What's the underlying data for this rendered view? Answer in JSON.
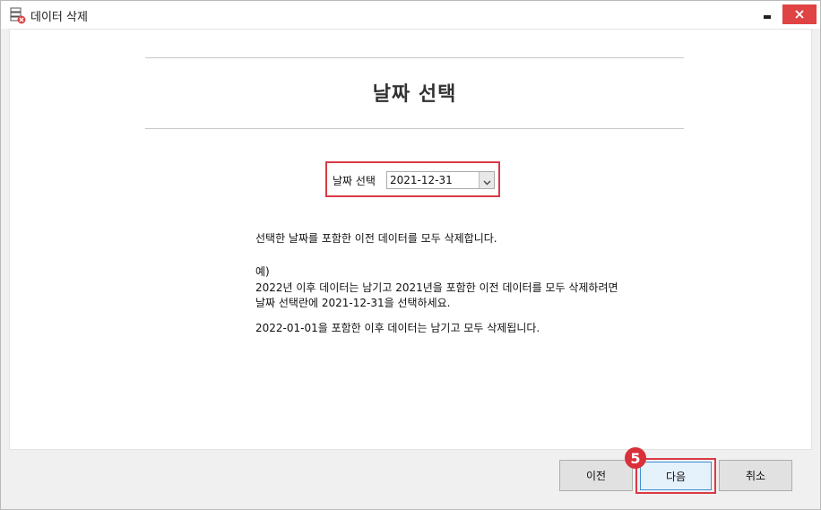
{
  "window": {
    "title": "데이터 삭제",
    "icon": "database-delete-icon"
  },
  "main": {
    "heading": "날짜 선택",
    "date_selector": {
      "label": "날짜 선택",
      "value": "2021-12-31"
    },
    "description": {
      "line1": "선택한 날짜를 포함한 이전 데이터를 모두 삭제합니다.",
      "example_label": "예)",
      "example_line1": "2022년 이후 데이터는 남기고 2021년을 포함한 이전 데이터를 모두 삭제하려면",
      "example_line2": "날짜 선택란에 2021-12-31을 선택하세요.",
      "result_line": "2022-01-01을 포함한 이후 데이터는 남기고 모두 삭제됩니다."
    }
  },
  "footer": {
    "prev_label": "이전",
    "next_label": "다음",
    "cancel_label": "취소",
    "step_badge": "5"
  },
  "colors": {
    "highlight": "#d93a45",
    "close_button": "#e04343",
    "primary_button_bg": "#e5f1fb",
    "primary_button_border": "#3c8fd8"
  }
}
